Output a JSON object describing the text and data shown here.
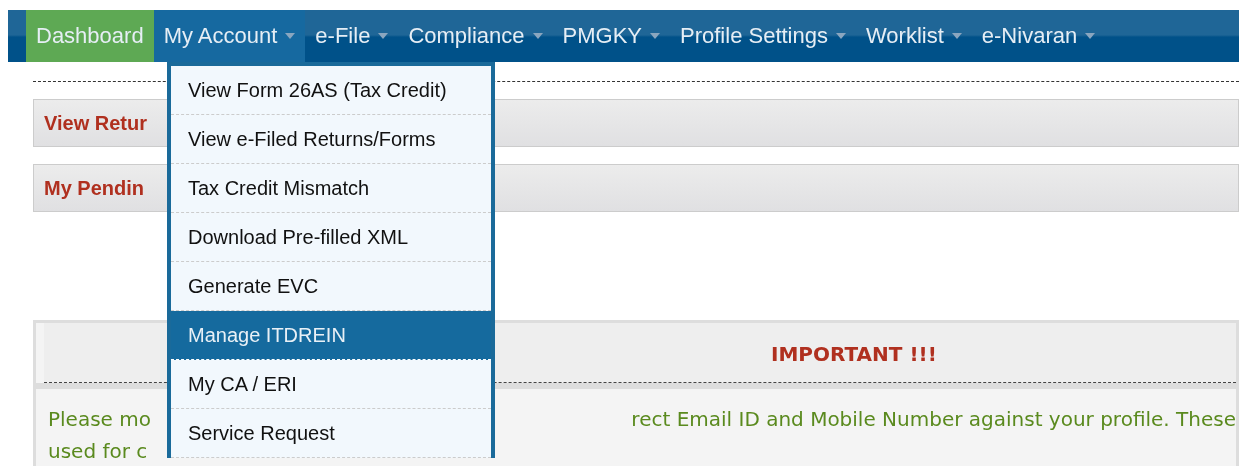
{
  "nav": [
    {
      "label": "Dashboard",
      "kind": "home",
      "selected": false
    },
    {
      "label": "My Account",
      "kind": "menu",
      "selected": true
    },
    {
      "label": "e-File",
      "kind": "menu",
      "selected": false
    },
    {
      "label": "Compliance",
      "kind": "menu",
      "selected": false
    },
    {
      "label": "PMGKY",
      "kind": "menu",
      "selected": false
    },
    {
      "label": "Profile Settings",
      "kind": "menu",
      "selected": false
    },
    {
      "label": "Worklist",
      "kind": "menu",
      "selected": false
    },
    {
      "label": "e-Nivaran",
      "kind": "menu",
      "selected": false
    }
  ],
  "dropdown": [
    {
      "label": "View Form 26AS (Tax Credit)",
      "selected": false
    },
    {
      "label": "View e-Filed Returns/Forms",
      "selected": false
    },
    {
      "label": "Tax Credit Mismatch",
      "selected": false
    },
    {
      "label": "Download Pre-filled XML",
      "selected": false
    },
    {
      "label": "Generate EVC",
      "selected": false
    },
    {
      "label": "Manage ITDREIN",
      "selected": true
    },
    {
      "label": "My CA / ERI",
      "selected": false
    },
    {
      "label": "Service Request",
      "selected": false
    }
  ],
  "panels": [
    {
      "title": "View Retur"
    },
    {
      "title": "My Pendin"
    }
  ],
  "notice": {
    "heading": "IMPORTANT !!!",
    "lines": [
      {
        "left": "Please mo",
        "right": "rect Email ID and Mobile Number against your profile. These"
      },
      {
        "left": "used for c"
      }
    ]
  }
}
